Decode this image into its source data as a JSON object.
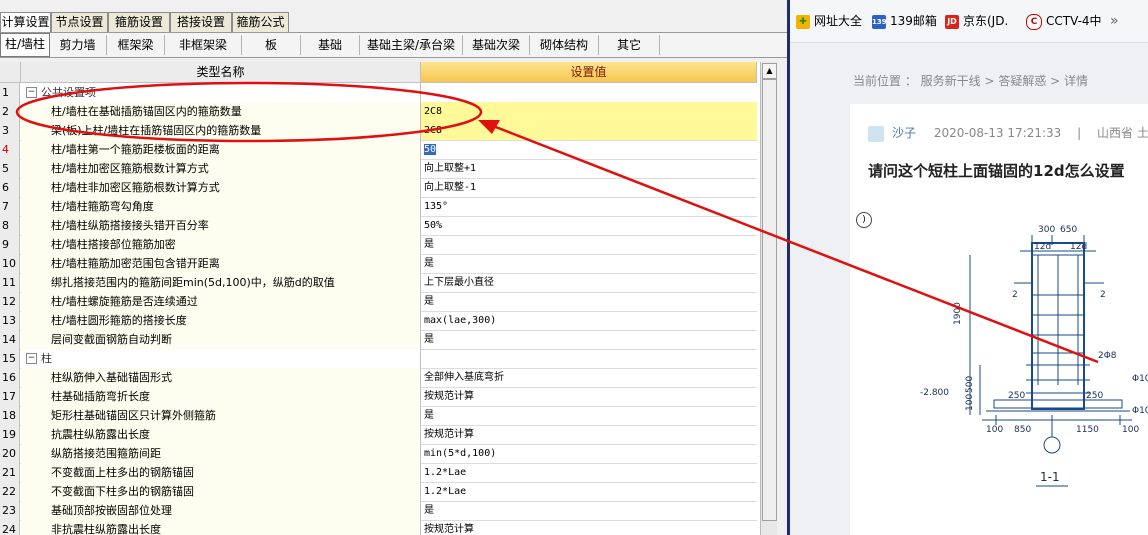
{
  "toolbar_tabs": [
    "计算设置",
    "节点设置",
    "箍筋设置",
    "搭接设置",
    "箍筋公式"
  ],
  "sub_tabs": [
    "柱/墙柱",
    "剪力墙",
    "框架梁",
    "非框架梁",
    "板",
    "基础",
    "基础主梁/承台梁",
    "基础次梁",
    "砌体结构",
    "其它"
  ],
  "table": {
    "header": {
      "col_name": "类型名称",
      "col_value": "设置值"
    },
    "rows": [
      {
        "num": "1",
        "name": "公共设置项",
        "value": "",
        "group": true
      },
      {
        "num": "2",
        "name": "柱/墙柱在基础插筋锚固区内的箍筋数量",
        "value": "2C8"
      },
      {
        "num": "3",
        "name": "梁(板)上柱/墙柱在插筋锚固区内的箍筋数量",
        "value": "2C8"
      },
      {
        "num": "4",
        "name": "柱/墙柱第一个箍筋距楼板面的距离",
        "value": "50"
      },
      {
        "num": "5",
        "name": "柱/墙柱加密区箍筋根数计算方式",
        "value": "向上取整+1"
      },
      {
        "num": "6",
        "name": "柱/墙柱非加密区箍筋根数计算方式",
        "value": "向上取整-1"
      },
      {
        "num": "7",
        "name": "柱/墙柱箍筋弯勾角度",
        "value": "135°"
      },
      {
        "num": "8",
        "name": "柱/墙柱纵筋搭接接头错开百分率",
        "value": "50%"
      },
      {
        "num": "9",
        "name": "柱/墙柱搭接部位箍筋加密",
        "value": "是"
      },
      {
        "num": "10",
        "name": "柱/墙柱箍筋加密范围包含错开距离",
        "value": "是"
      },
      {
        "num": "11",
        "name": "绑扎搭接范围内的箍筋间距min(5d,100)中，纵筋d的取值",
        "value": "上下层最小直径"
      },
      {
        "num": "12",
        "name": "柱/墙柱螺旋箍筋是否连续通过",
        "value": "是"
      },
      {
        "num": "13",
        "name": "柱/墙柱圆形箍筋的搭接长度",
        "value": "max(lae,300)"
      },
      {
        "num": "14",
        "name": "层间变截面钢筋自动判断",
        "value": "是"
      },
      {
        "num": "15",
        "name": "柱",
        "value": "",
        "group": true
      },
      {
        "num": "16",
        "name": "柱纵筋伸入基础锚固形式",
        "value": "全部伸入基底弯折"
      },
      {
        "num": "17",
        "name": "柱基础插筋弯折长度",
        "value": "按规范计算"
      },
      {
        "num": "18",
        "name": "矩形柱基础锚固区只计算外侧箍筋",
        "value": "是"
      },
      {
        "num": "19",
        "name": "抗震柱纵筋露出长度",
        "value": "按规范计算"
      },
      {
        "num": "20",
        "name": "纵筋搭接范围箍筋间距",
        "value": "min(5*d,100)"
      },
      {
        "num": "21",
        "name": "不变截面上柱多出的钢筋锚固",
        "value": "1.2*Lae"
      },
      {
        "num": "22",
        "name": "不变截面下柱多出的钢筋锚固",
        "value": "1.2*Lae"
      },
      {
        "num": "23",
        "name": "基础顶部按嵌固部位处理",
        "value": "是"
      },
      {
        "num": "24",
        "name": "非抗震柱纵筋露出长度",
        "value": "按规范计算"
      }
    ]
  },
  "browser": {
    "bookmarks": [
      {
        "label": "网址大全",
        "icon": "web-directory-icon"
      },
      {
        "label": "139邮箱",
        "icon": "mail-139-icon"
      },
      {
        "label": "京东(JD.",
        "icon": "jd-icon"
      },
      {
        "label": "CCTV-4中",
        "icon": "cctv-icon"
      }
    ],
    "more": "»",
    "breadcrumb": "当前位置 ： 服务新干线 > 答疑解惑 > 详情",
    "author": "沙子",
    "date": "2020-08-13 17:21:33",
    "location": "山西省 土",
    "sep": "|",
    "question_title": "请问这个短柱上面锚固的12d怎么设置",
    "drawing": {
      "dims_top": [
        "300",
        "650"
      ],
      "dims_12d": [
        "12d",
        "12d"
      ],
      "height": "1900",
      "side_labels": [
        "2",
        "2"
      ],
      "rebar_label": "2Φ8",
      "elev": "-2.800",
      "dims_bottom": [
        "100",
        "850",
        "1150",
        "100"
      ],
      "dims_250": [
        "250",
        "250"
      ],
      "dims_left": [
        "100",
        "500"
      ],
      "right_labels": [
        "Φ10@",
        "Φ10@"
      ],
      "section": "1-1"
    }
  }
}
